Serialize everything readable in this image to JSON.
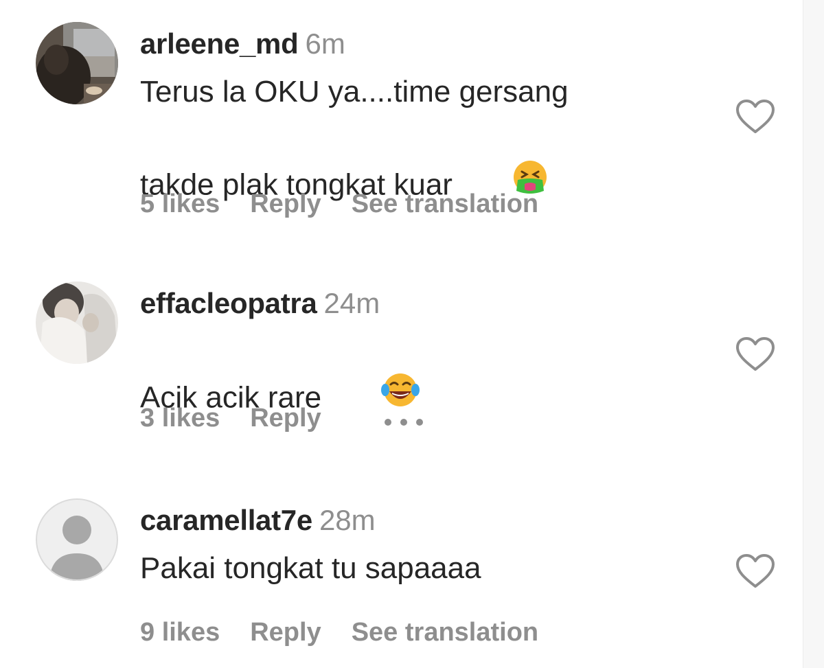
{
  "comments": [
    {
      "username": "arleene_md",
      "time": "6m",
      "text": "Terus la OKU ya....time gersang\ntakde plak tongkat kuar",
      "emoji": "nauseated-face",
      "likes": "5 likes",
      "reply": "Reply",
      "extra": "See translation"
    },
    {
      "username": "effacleopatra",
      "time": "24m",
      "text": "Acik acik rare",
      "emoji": "tears-of-joy-face",
      "likes": "3 likes",
      "reply": "Reply",
      "extra": "more-options"
    },
    {
      "username": "caramellat7e",
      "time": "28m",
      "text": "Pakai tongkat tu sapaaaa",
      "emoji": "",
      "likes": "9 likes",
      "reply": "Reply",
      "extra": "See translation"
    }
  ],
  "colors": {
    "text": "#262626",
    "muted": "#8e8e8e",
    "heart_outline": "#8e8e8e"
  }
}
